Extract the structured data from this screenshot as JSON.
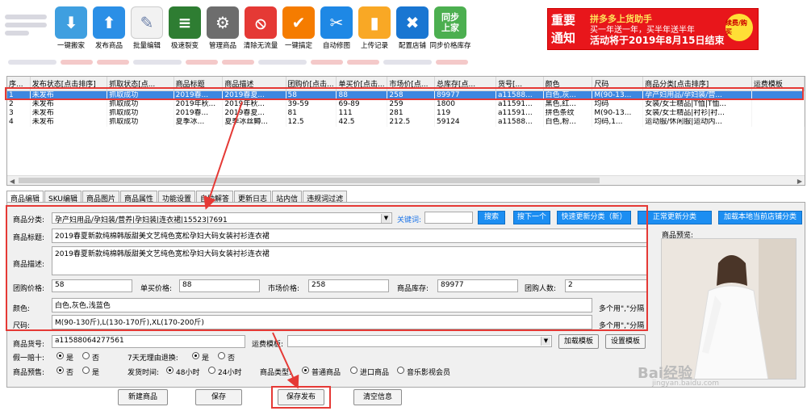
{
  "toolbar": {
    "tools": [
      {
        "label": "一键搬家",
        "icon": "download-icon",
        "color": "#3f9fe0",
        "glyph": "⬇"
      },
      {
        "label": "发布商品",
        "icon": "upload-icon",
        "color": "#2b8fe6",
        "glyph": "⬆"
      },
      {
        "label": "批量编辑",
        "icon": "document-edit-icon",
        "color": "#f2f2f2",
        "glyph": "✎"
      },
      {
        "label": "极速裂变",
        "icon": "layers-icon",
        "color": "#2e7d32",
        "glyph": "≡"
      },
      {
        "label": "管理商品",
        "icon": "gear-icon",
        "color": "#6d6d6d",
        "glyph": "⚙"
      },
      {
        "label": "清除无流量",
        "icon": "no-entry-icon",
        "color": "#e53935",
        "glyph": "⦸"
      },
      {
        "label": "一键搞定",
        "icon": "tag-icon",
        "color": "#f57c00",
        "glyph": "✔"
      },
      {
        "label": "自动修图",
        "icon": "scissors-icon",
        "color": "#1e88e5",
        "glyph": "✂"
      },
      {
        "label": "上传记录",
        "icon": "bookmark-icon",
        "color": "#f9a825",
        "glyph": "▮"
      },
      {
        "label": "配置店铺",
        "icon": "tools-icon",
        "color": "#1976d2",
        "glyph": "✖"
      },
      {
        "label": "同步价格库存",
        "icon": "sync-text-icon",
        "color": "#4caf50",
        "glyph": "同步上家"
      }
    ]
  },
  "ad": {
    "big": "重要通知",
    "line1": "拼多多上货助手",
    "line2": "买一年送一年，买半年送半年",
    "line3": "活动将于2019年8月15日结束",
    "badge": "续费/购买"
  },
  "grid": {
    "headers": [
      "序...",
      "发布状态[点击排序]",
      "抓取状态[点...",
      "商品标题",
      "商品描述",
      "团购价[点击...",
      "单买价[点击...",
      "市场价[点...",
      "总库存[点...",
      "货号[...",
      "颜色",
      "尺码",
      "商品分类[点击排序]",
      "运费模板"
    ],
    "rows": [
      [
        "1",
        "未发布",
        "抓取成功",
        "2019春...",
        "2019春夏...",
        "58",
        "88",
        "258",
        "89977",
        "a11588...",
        "白色,灰...",
        "M(90-13...",
        "孕产妇用品/孕妇装/营...",
        ""
      ],
      [
        "2",
        "未发布",
        "抓取成功",
        "2019年秋...",
        "2019年秋...",
        "39-59",
        "69-89",
        "259",
        "1800",
        "a11591...",
        "黑色,红...",
        "均码",
        "女装/女士精品|T恤|T恤...",
        ""
      ],
      [
        "3",
        "未发布",
        "抓取成功",
        "2019春...",
        "2019春夏...",
        "81",
        "111",
        "281",
        "119",
        "a11591...",
        "拼色条纹",
        "M(90-13...",
        "女装/女士精品|衬衫|衬...",
        ""
      ],
      [
        "4",
        "未发布",
        "抓取成功",
        "夏季冰...",
        "夏季冰丝鳟...",
        "12.5",
        "42.5",
        "212.5",
        "59124",
        "a11588...",
        "白色,粉...",
        "均码,1...",
        "运动服/休闲服|运动内...",
        ""
      ]
    ]
  },
  "tabs": [
    "商品编辑",
    "SKU编辑",
    "商品图片",
    "商品属性",
    "功能设置",
    "自助解答",
    "更新日志",
    "站内信",
    "违规词过滤"
  ],
  "form": {
    "category_label": "商品分类:",
    "category_value": "孕产妇用品/孕妇装/营养|孕妇装|连衣裙|15523|7691",
    "keyword_label": "关键词:",
    "keyword_value": "",
    "search_btn": "搜索",
    "next_btn": "搜下一个",
    "quick_update_btn": "快速更新分类（新）",
    "normal_update_btn": "正常更新分类",
    "load_cat_btn": "加载本地当前店铺分类",
    "title_label": "商品标题:",
    "title_value": "2019春夏新款纯棉韩版甜美文艺纯色宽松孕妇大码女装衬衫连衣裙",
    "desc_label": "商品描述:",
    "desc_value": "2019春夏新款纯棉韩版甜美文艺纯色宽松孕妇大码女装衬衫连衣裙",
    "group_price_label": "团购价格:",
    "group_price_value": "58",
    "single_price_label": "单买价格:",
    "single_price_value": "88",
    "market_price_label": "市场价格:",
    "market_price_value": "258",
    "stock_label": "商品库存:",
    "stock_value": "89977",
    "group_num_label": "团购人数:",
    "group_num_value": "2",
    "color_label": "颜色:",
    "color_value": "白色,灰色,浅蓝色",
    "color_hint": "多个用\",\"分隔",
    "size_label": "尺码:",
    "size_value": "M(90-130斤),L(130-170斤),XL(170-200斤)",
    "size_hint": "多个用\",\"分隔",
    "sku_label": "商品货号:",
    "sku_value": "a11588064277561",
    "freight_label": "运费模板:",
    "freight_value": "",
    "load_template_btn": "加载模板",
    "setup_template_btn": "设置模板",
    "fake_label": "假一赔十:",
    "refund_label": "7天无理由退换:",
    "presale_label": "商品预售:",
    "ship_label": "发货时间:",
    "type_label": "商品类型:",
    "yes": "是",
    "no": "否",
    "h48": "48小时",
    "h24": "24小时",
    "type_normal": "普通商品",
    "type_import": "进口商品",
    "type_music": "音乐影视会员",
    "preview_label": "商品预览:"
  },
  "bottom": {
    "new_btn": "新建商品",
    "save_btn": "保存",
    "save_publish_btn": "保存发布",
    "clear_btn": "清空信息"
  },
  "watermark": {
    "big": "Bai经验",
    "small": "jingyan.baidu.com"
  }
}
